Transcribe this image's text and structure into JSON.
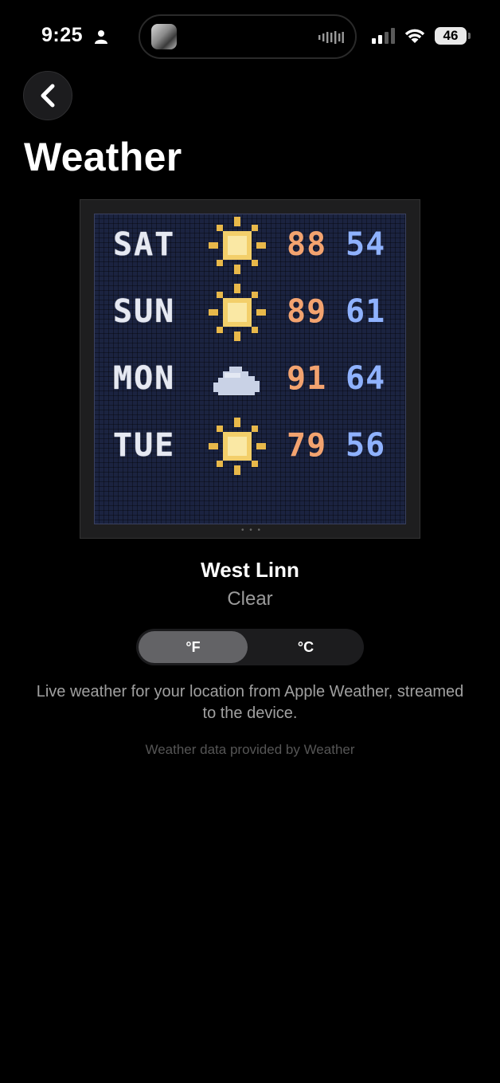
{
  "status_bar": {
    "time": "9:25",
    "battery": "46"
  },
  "header": {
    "title": "Weather"
  },
  "device": {
    "rows": [
      {
        "day": "SAT",
        "icon": "sun-icon",
        "high": "88",
        "low": "54"
      },
      {
        "day": "SUN",
        "icon": "sun-icon",
        "high": "89",
        "low": "61"
      },
      {
        "day": "MON",
        "icon": "cloud-icon",
        "high": "91",
        "low": "64"
      },
      {
        "day": "TUE",
        "icon": "sun-icon",
        "high": "79",
        "low": "56"
      }
    ],
    "colors": {
      "high": "#f3a36f",
      "low": "#8fb2ff",
      "screen": "#1b2340"
    }
  },
  "weather": {
    "location": "West Linn",
    "condition": "Clear"
  },
  "unit_toggle": {
    "fahrenheit": "°F",
    "celsius": "°C",
    "selected": "°F"
  },
  "description": "Live weather for your location from Apple Weather, streamed to the device.",
  "attribution": "Weather data provided by  Weather"
}
